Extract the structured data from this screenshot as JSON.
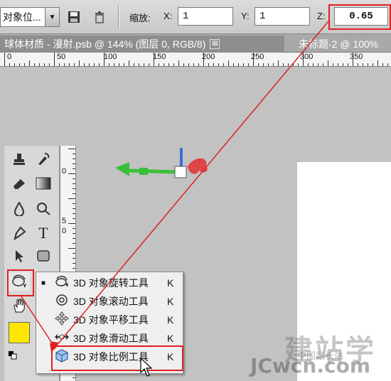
{
  "options_bar": {
    "preset_value": "对象位...",
    "zoom_label": "缩放:",
    "x_label": "X:",
    "x_value": "1",
    "y_label": "Y:",
    "y_value": "1",
    "z_label": "Z:",
    "z_value": "0.65"
  },
  "tabs": [
    {
      "label": "球体材质 - 漫射.psb @ 144% (图层 0, RGB/8)",
      "close": "⊠"
    },
    {
      "label": "未标题-2 @ 100%"
    }
  ],
  "ruler": {
    "numbers": [
      "0",
      "50",
      "100",
      "150",
      "200",
      "250",
      "300",
      "350"
    ]
  },
  "vruler": {
    "numbers": [
      "0",
      "5",
      "0",
      "5"
    ]
  },
  "tools": {
    "fg_color": "#ffe600"
  },
  "flyout": {
    "items": [
      {
        "bullet": "■",
        "label": "3D 对象旋转工具",
        "key": "K"
      },
      {
        "bullet": "",
        "label": "3D 对象滚动工具",
        "key": "K"
      },
      {
        "bullet": "",
        "label": "3D 对象平移工具",
        "key": "K"
      },
      {
        "bullet": "",
        "label": "3D 对象滑动工具",
        "key": "K"
      },
      {
        "bullet": "",
        "label": "3D 对象比例工具",
        "key": "K"
      }
    ]
  },
  "watermark": {
    "line1": "建站学",
    "line2": "JCwcn.com",
    "line3": "中国站长站"
  },
  "colors": {
    "highlight": "#e02020",
    "axis_green": "#3bbf3b",
    "axis_red": "#e04545",
    "axis_blue": "#3b6fd6"
  }
}
